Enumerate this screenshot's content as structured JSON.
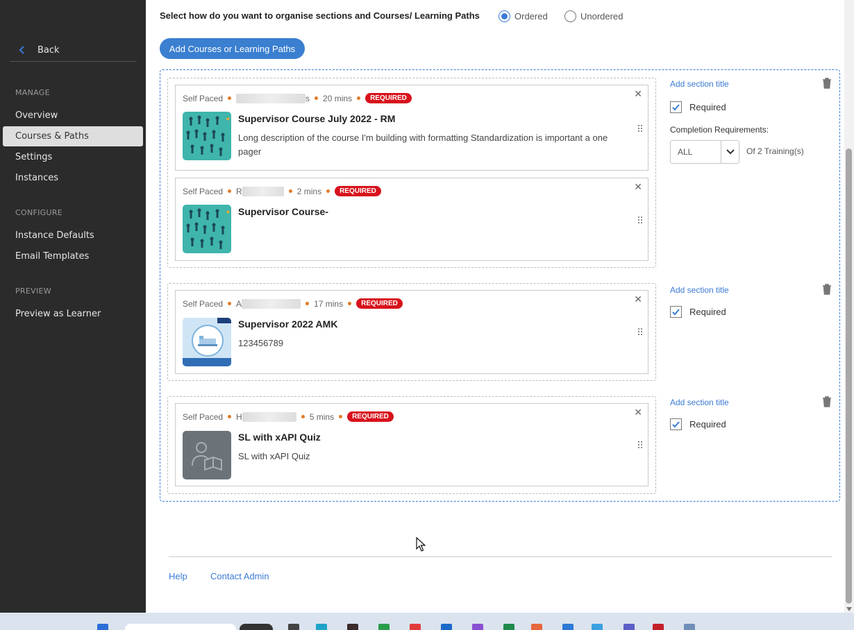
{
  "sidebar": {
    "back_label": "Back",
    "groups": [
      {
        "heading": "MANAGE",
        "items": [
          "Overview",
          "Courses & Paths",
          "Settings",
          "Instances"
        ]
      },
      {
        "heading": "CONFIGURE",
        "items": [
          "Instance Defaults",
          "Email Templates"
        ]
      },
      {
        "heading": "PREVIEW",
        "items": [
          "Preview as Learner"
        ]
      }
    ],
    "active_item": "Courses & Paths"
  },
  "organise": {
    "question": "Select how do you want to organise sections and Courses/ Learning Paths",
    "options": [
      "Ordered",
      "Unordered"
    ],
    "selected": "Ordered"
  },
  "add_button_label": "Add Courses or Learning Paths",
  "sections": [
    {
      "title_link": "Add section title",
      "required_label": "Required",
      "required_checked": true,
      "completion_label": "Completion Requirements:",
      "completion_value": "ALL",
      "completion_of": "Of 2 Training(s)",
      "cards": [
        {
          "type": "Self Paced",
          "author_tail": "s",
          "duration": "20 mins",
          "badge": "REQUIRED",
          "title": "Supervisor Course July 2022 - RM",
          "description": "Long description of the course I'm building with formatting Standardization is important a one pager",
          "thumb": "people"
        },
        {
          "type": "Self Paced",
          "author_tail": "R",
          "duration": "2 mins",
          "badge": "REQUIRED",
          "title": "Supervisor Course-",
          "description": "",
          "thumb": "people"
        }
      ]
    },
    {
      "title_link": "Add section title",
      "required_label": "Required",
      "required_checked": true,
      "cards": [
        {
          "type": "Self Paced",
          "author_tail": "A",
          "duration": "17 mins",
          "badge": "REQUIRED",
          "title": "Supervisor 2022 AMK",
          "description": "123456789",
          "thumb": "bed"
        }
      ]
    },
    {
      "title_link": "Add section title",
      "required_label": "Required",
      "required_checked": true,
      "cards": [
        {
          "type": "Self Paced",
          "author_tail": "H",
          "duration": "5 mins",
          "badge": "REQUIRED",
          "title": "SL with xAPI Quiz",
          "description": "SL with xAPI Quiz",
          "thumb": "reader"
        }
      ]
    }
  ],
  "footer": {
    "help": "Help",
    "contact": "Contact Admin"
  },
  "colors": {
    "sidebar_bg": "#2b2b2b",
    "accent": "#3a7bd5",
    "badge": "#d8121c",
    "separator_dot": "#e07a26"
  }
}
